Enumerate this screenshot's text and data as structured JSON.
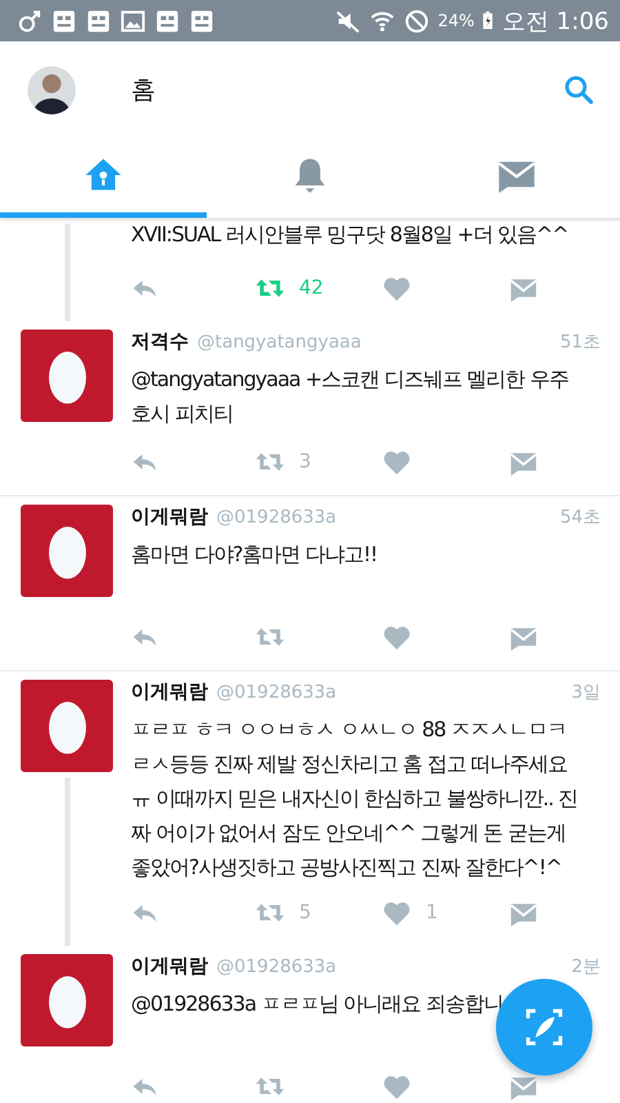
{
  "status_bar": {
    "battery": "24%",
    "time": "오전 1:06"
  },
  "header": {
    "title": "홈"
  },
  "tabs": [
    {
      "kind": "home",
      "selected": true
    },
    {
      "kind": "notifications",
      "selected": false
    },
    {
      "kind": "messages",
      "selected": false
    }
  ],
  "tweets": [
    {
      "kind": "partial",
      "text": "XVII:SUAL 러시안블루 밍구닷 8월8일 +더 있음^^",
      "retweets": "42",
      "retweeted": true,
      "thread_continues": true
    },
    {
      "name": "저격수",
      "handle": "@tangyatangyaaa",
      "time": "51초",
      "text": "@tangyatangyaaa +스코캔 디즈눼프 멜리한 우주호시 피치티",
      "retweets": "3",
      "retweeted": false,
      "thread_continues": false
    },
    {
      "name": "이게뭐람",
      "handle": "@01928633a",
      "time": "54초",
      "text": "홈마면 다야?홈마면 다냐고!!",
      "retweeted": false,
      "thread_continues": false
    },
    {
      "name": "이게뭐람",
      "handle": "@01928633a",
      "time": "3일",
      "text": "ㅍㄹㅍ ㅎㅋ ㅇㅇㅂㅎㅅ ㅇㅆㄴㅇ 88 ㅈㅈㅅㄴㅁㅋㄹㅅ등등 진짜 제발 정신차리고 홈 접고 떠나주세요ㅠ 이때까지 믿은 내자신이 한심하고 불쌍하니깐.. 진짜 어이가 없어서 잠도 안오네^^ 그렇게 돈 굳는게 좋았어?사생짓하고 공방사진찍고 진짜 잘한다^!^",
      "retweets": "5",
      "retweeted": false,
      "likes": "1",
      "thread_continues": true
    },
    {
      "name": "이게뭐람",
      "handle": "@01928633a",
      "time": "2분",
      "text": "@01928633a ㅍㄹㅍ님 아니래요 죄송합니",
      "retweeted": false,
      "thread_continues": false
    }
  ]
}
